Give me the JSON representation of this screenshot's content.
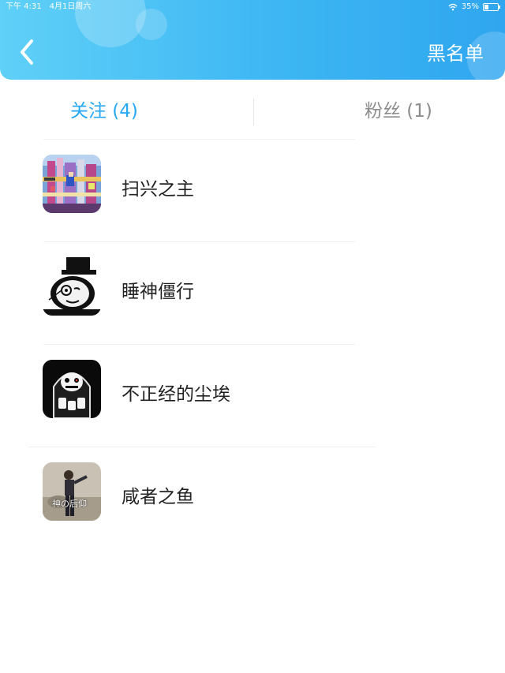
{
  "status_bar": {
    "time": "下午 4:31",
    "date": "4月1日周六",
    "battery": "35%"
  },
  "header": {
    "back_icon": "chevron-left-icon",
    "right_action": "黑名单"
  },
  "tabs": [
    {
      "label": "关注 (4)",
      "active": true
    },
    {
      "label": "粉丝 (1)",
      "active": false
    }
  ],
  "colors": {
    "accent": "#27a8f2",
    "header_start": "#5fd0f7",
    "header_end": "#2fa6ef",
    "inactive_tab": "#8c8c8c"
  },
  "list": [
    {
      "name": "扫兴之主",
      "avatar": "pixel-game-avatar"
    },
    {
      "name": "睡神僵行",
      "avatar": "panda-meme-avatar"
    },
    {
      "name": "不正经的尘埃",
      "avatar": "skeleton-hoodie-avatar"
    },
    {
      "name": "咸者之鱼",
      "avatar": "photo-person-avatar",
      "avatar_caption": "神の后仰"
    }
  ]
}
